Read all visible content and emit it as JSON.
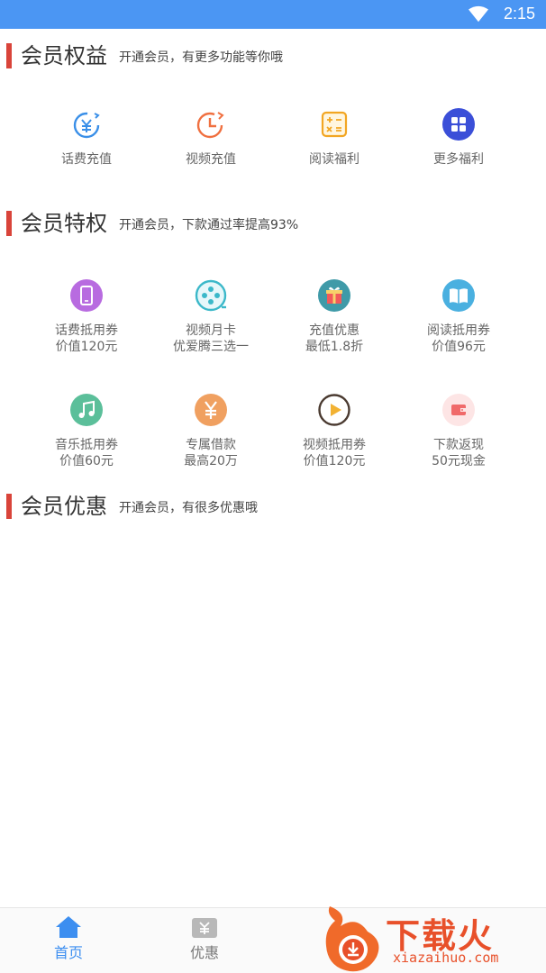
{
  "status_bar": {
    "time": "2:15"
  },
  "sections": [
    {
      "title": "会员权益",
      "subtitle": "开通会员，有更多功能等你哦"
    },
    {
      "title": "会员特权",
      "subtitle": "开通会员，下款通过率提高93%"
    },
    {
      "title": "会员优惠",
      "subtitle": "开通会员，有很多优惠哦"
    }
  ],
  "benefits": [
    {
      "label": "话费充值",
      "icon": "currency-refresh-icon"
    },
    {
      "label": "视频充值",
      "icon": "clock-refresh-icon"
    },
    {
      "label": "阅读福利",
      "icon": "calculator-icon"
    },
    {
      "label": "更多福利",
      "icon": "grid-apps-icon"
    }
  ],
  "privileges": [
    {
      "label": "话费抵用券",
      "sub": "价值120元",
      "icon": "phone-icon",
      "color": "#b86be0"
    },
    {
      "label": "视频月卡",
      "sub": "优爱腾三选一",
      "icon": "film-reel-icon",
      "color": "#3bb8c9"
    },
    {
      "label": "充值优惠",
      "sub": "最低1.8折",
      "icon": "gift-icon",
      "color": "#3f9aa8"
    },
    {
      "label": "阅读抵用券",
      "sub": "价值96元",
      "icon": "book-icon",
      "color": "#4ab0e0"
    },
    {
      "label": "音乐抵用券",
      "sub": "价值60元",
      "icon": "music-note-icon",
      "color": "#5bbf9a"
    },
    {
      "label": "专属借款",
      "sub": "最高20万",
      "icon": "yen-icon",
      "color": "#f0a060"
    },
    {
      "label": "视频抵用券",
      "sub": "价值120元",
      "icon": "play-icon",
      "color": "#f2b233"
    },
    {
      "label": "下款返现",
      "sub": "50元现金",
      "icon": "wallet-icon",
      "color": "#f06a6a"
    }
  ],
  "tabbar": [
    {
      "label": "首页",
      "active": true
    },
    {
      "label": "优惠",
      "active": false
    }
  ],
  "watermark": {
    "brand": "下载火",
    "domain": "xiazaihuo.com"
  },
  "colors": {
    "status_bar": "#4b96f3",
    "accent_bar": "#d9443a",
    "tab_active": "#3c8ef0"
  }
}
